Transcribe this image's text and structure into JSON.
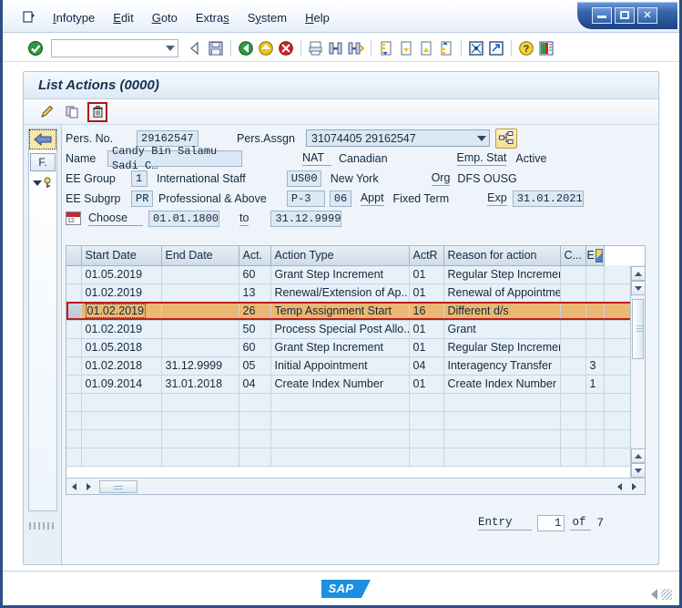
{
  "window": {
    "minimize_label": "_",
    "maximize_label": "□",
    "close_label": "✕"
  },
  "menubar": {
    "items": [
      {
        "label": "Infotype"
      },
      {
        "label": "Edit"
      },
      {
        "label": "Goto"
      },
      {
        "label": "Extras"
      },
      {
        "label": "System"
      },
      {
        "label": "Help"
      }
    ]
  },
  "toolbar": {
    "command_field_value": "",
    "icons": [
      "back-arrow-icon",
      "save-icon",
      "exit-green-icon",
      "back-yellow-icon",
      "cancel-red-icon",
      "print-icon",
      "find-icon",
      "find-next-icon",
      "first-page-icon",
      "previous-page-icon",
      "next-page-icon",
      "last-page-icon",
      "create-session-icon",
      "create-shortcut-icon",
      "help-icon",
      "customize-icon"
    ]
  },
  "panel": {
    "title": "List Actions (0000)",
    "app_buttons": [
      {
        "name": "display-edit-button",
        "icon": "pencil-icon",
        "selected": false
      },
      {
        "name": "copy-button",
        "icon": "copy-icon",
        "selected": false
      },
      {
        "name": "delete-button",
        "icon": "trash-icon",
        "selected": true
      }
    ]
  },
  "leftstrip": {
    "back_button_label": "",
    "f_button_label": "F."
  },
  "form": {
    "pers_no_label": "Pers. No.",
    "pers_no_value": "29162547",
    "pers_assgn_label": "Pers.Assgn",
    "pers_assgn_value": "31074405 29162547",
    "name_label": "Name",
    "name_value": "Candy Bin Salamu Sadi C…",
    "nat_label": "NAT",
    "nat_value": "Canadian",
    "emp_stat_label": "Emp. Stat",
    "emp_stat_value": "Active",
    "ee_group_label": "EE Group",
    "ee_group_code": "1",
    "ee_group_text": "International Staff",
    "location_code": "US00",
    "location_text": "New York",
    "org_label": "Org",
    "org_value": "DFS OUSG",
    "ee_subgrp_label": "EE Subgrp",
    "ee_subgrp_code": "PR",
    "ee_subgrp_text": "Professional & Above",
    "grade_code": "P-3",
    "step_code": "06",
    "appt_label": "Appt",
    "appt_value": "Fixed Term",
    "exp_label": "Exp",
    "exp_value": "31.01.2021",
    "choose_label": "Choose",
    "choose_from": "01.01.1800",
    "to_label": "to",
    "choose_to": "31.12.9999"
  },
  "table": {
    "columns": [
      "Start Date",
      "End Date",
      "Act.",
      "Action Type",
      "ActR",
      "Reason for action",
      "C...",
      "E"
    ],
    "rows": [
      {
        "start": "01.05.2019",
        "end": "",
        "act": "60",
        "type": "Grant Step Increment",
        "actr": "01",
        "reason": "Regular Step Increment",
        "c": "",
        "e": "",
        "selected": false
      },
      {
        "start": "01.02.2019",
        "end": "",
        "act": "13",
        "type": "Renewal/Extension of Ap..",
        "actr": "01",
        "reason": "Renewal of Appointment",
        "c": "",
        "e": "",
        "selected": false
      },
      {
        "start": "01.02.2019",
        "end": "",
        "act": "26",
        "type": "Temp Assignment Start",
        "actr": "16",
        "reason": "Different d/s",
        "c": "",
        "e": "",
        "selected": true
      },
      {
        "start": "01.02.2019",
        "end": "",
        "act": "50",
        "type": "Process Special Post Allo..",
        "actr": "01",
        "reason": "Grant",
        "c": "",
        "e": "",
        "selected": false
      },
      {
        "start": "01.05.2018",
        "end": "",
        "act": "60",
        "type": "Grant Step Increment",
        "actr": "01",
        "reason": "Regular Step Increment",
        "c": "",
        "e": "",
        "selected": false
      },
      {
        "start": "01.02.2018",
        "end": "31.12.9999",
        "act": "05",
        "type": "Initial Appointment",
        "actr": "04",
        "reason": "Interagency Transfer",
        "c": "",
        "e": "3",
        "selected": false
      },
      {
        "start": "01.09.2014",
        "end": "31.01.2018",
        "act": "04",
        "type": "Create Index Number",
        "actr": "01",
        "reason": "Create Index Number",
        "c": "",
        "e": "1",
        "selected": false
      },
      {
        "start": "",
        "end": "",
        "act": "",
        "type": "",
        "actr": "",
        "reason": "",
        "c": "",
        "e": "",
        "selected": false
      },
      {
        "start": "",
        "end": "",
        "act": "",
        "type": "",
        "actr": "",
        "reason": "",
        "c": "",
        "e": "",
        "selected": false
      },
      {
        "start": "",
        "end": "",
        "act": "",
        "type": "",
        "actr": "",
        "reason": "",
        "c": "",
        "e": "",
        "selected": false
      },
      {
        "start": "",
        "end": "",
        "act": "",
        "type": "",
        "actr": "",
        "reason": "",
        "c": "",
        "e": "",
        "selected": false
      }
    ]
  },
  "entry": {
    "label": "Entry",
    "current": "1",
    "of_label": "of",
    "total": "7"
  },
  "statusbar": {
    "logo_text": "SAP"
  },
  "colors": {
    "selected_row": "#eab873",
    "selection_border": "#c11b1b",
    "field_bg": "#dce9f4",
    "grid_bg": "#e8f1f8",
    "titlebar_blue": "#2c4e86",
    "sap_blue": "#1d8ee0"
  }
}
